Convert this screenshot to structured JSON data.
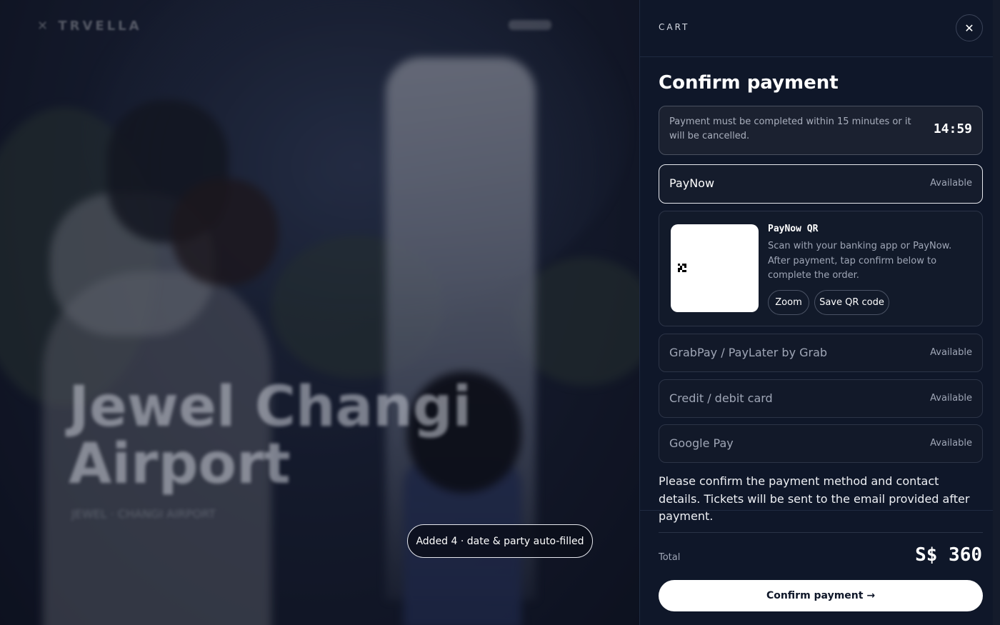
{
  "background": {
    "brand": "✕ TRVELLA",
    "hero_title_line1": "Jewel Changi",
    "hero_title_line2": "Airport",
    "hero_subtitle": "JEWEL · CHANGI AIRPORT"
  },
  "toast": {
    "text": "Added 4 · date & party auto-filled"
  },
  "cart": {
    "header_label": "CART",
    "close_symbol": "✕",
    "title": "Confirm payment",
    "timer": {
      "message": "Payment must be completed within 15 minutes or it will be cancelled.",
      "countdown": "14:59"
    },
    "methods": [
      {
        "name": "PayNow",
        "status": "Available",
        "selected": true
      },
      {
        "name": "GrabPay / PayLater by Grab",
        "status": "Available",
        "selected": false
      },
      {
        "name": "Credit / debit card",
        "status": "Available",
        "selected": false
      },
      {
        "name": "Google Pay",
        "status": "Available",
        "selected": false
      }
    ],
    "paynow_qr": {
      "title": "PayNow QR",
      "description": "Scan with your banking app or PayNow. After payment, tap confirm below to complete the order.",
      "zoom_label": "Zoom",
      "save_label": "Save QR code"
    },
    "notice": "Please confirm the payment method and contact details. Tickets will be sent to the email provided after payment.",
    "total_label": "Total",
    "total_value": "S$ 360",
    "confirm_label": "Confirm payment →"
  },
  "colors": {
    "panel_bg": "#0f1729",
    "accent": "#ffffff",
    "muted_text": "#9fa6b6"
  }
}
